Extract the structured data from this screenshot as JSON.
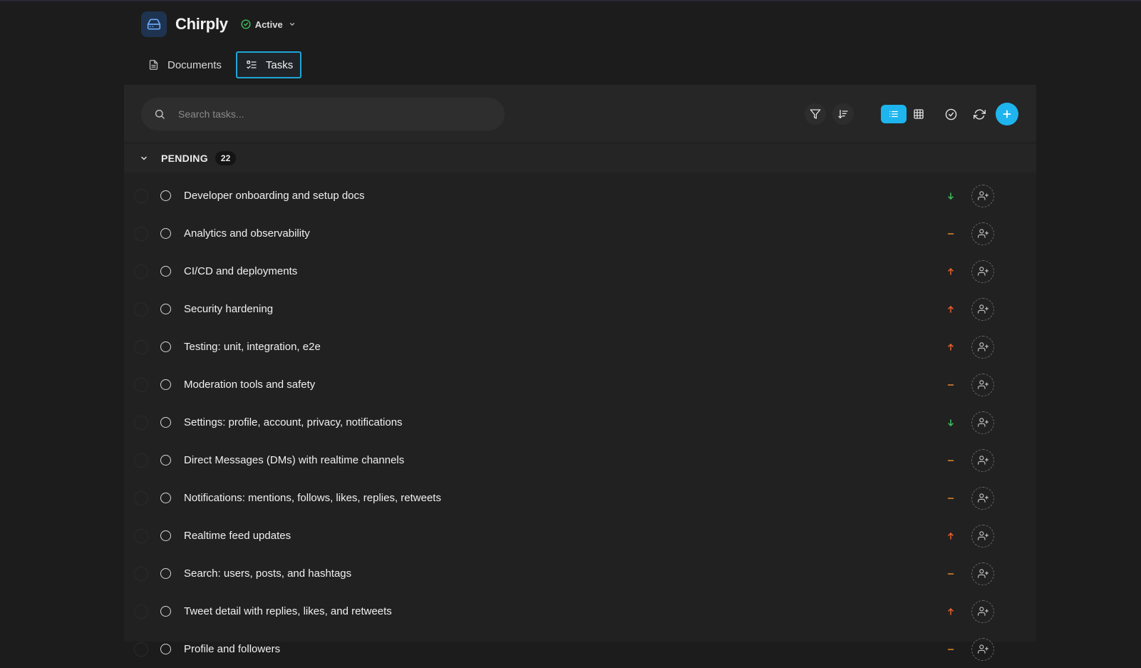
{
  "app": {
    "title": "Chirply",
    "status": "Active",
    "accent_color": "#1eb4ee"
  },
  "tabs": [
    {
      "label": "Documents",
      "icon": "file-icon",
      "active": false
    },
    {
      "label": "Tasks",
      "icon": "checklist-icon",
      "active": true
    }
  ],
  "search": {
    "placeholder": "Search tasks...",
    "value": ""
  },
  "toolbar": {
    "icons": [
      "filter-icon",
      "sort-icon",
      "list-view-icon",
      "grid-view-icon",
      "check-circle-icon",
      "refresh-icon",
      "plus-icon"
    ],
    "active_view": "list"
  },
  "group": {
    "title": "PENDING",
    "count": "22"
  },
  "priority_colors": {
    "low": "#3fbf5f",
    "medium": "#e08a2e",
    "high": "#e9612e"
  },
  "tasks": [
    {
      "title": "Developer onboarding and setup docs",
      "priority": "low"
    },
    {
      "title": "Analytics and observability",
      "priority": "medium"
    },
    {
      "title": "CI/CD and deployments",
      "priority": "high"
    },
    {
      "title": "Security hardening",
      "priority": "high"
    },
    {
      "title": "Testing: unit, integration, e2e",
      "priority": "high"
    },
    {
      "title": "Moderation tools and safety",
      "priority": "medium"
    },
    {
      "title": "Settings: profile, account, privacy, notifications",
      "priority": "low"
    },
    {
      "title": "Direct Messages (DMs) with realtime channels",
      "priority": "medium"
    },
    {
      "title": "Notifications: mentions, follows, likes, replies, retweets",
      "priority": "medium"
    },
    {
      "title": "Realtime feed updates",
      "priority": "high"
    },
    {
      "title": "Search: users, posts, and hashtags",
      "priority": "medium"
    },
    {
      "title": "Tweet detail with replies, likes, and retweets",
      "priority": "high"
    },
    {
      "title": "Profile and followers",
      "priority": "medium"
    }
  ]
}
